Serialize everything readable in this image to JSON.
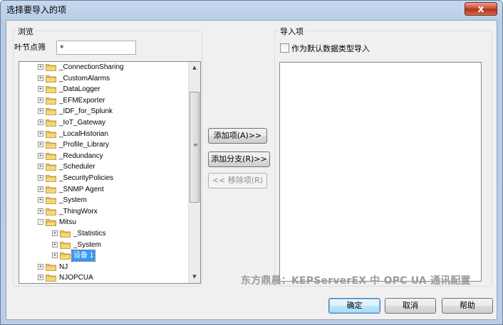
{
  "window": {
    "title": "选择要导入的项",
    "close_label": "x"
  },
  "browse": {
    "group_label": "浏览",
    "leaf_filter_label": "叶节点筛",
    "leaf_filter_value": "*"
  },
  "tree": {
    "items": [
      {
        "label": "_ConnectionSharing",
        "level": 1,
        "expander": "+"
      },
      {
        "label": "_CustomAlarms",
        "level": 1,
        "expander": "+"
      },
      {
        "label": "_DataLogger",
        "level": 1,
        "expander": "+"
      },
      {
        "label": "_EFMExporter",
        "level": 1,
        "expander": "+"
      },
      {
        "label": "_IDF_for_Splunk",
        "level": 1,
        "expander": "+"
      },
      {
        "label": "_IoT_Gateway",
        "level": 1,
        "expander": "+"
      },
      {
        "label": "_LocalHistorian",
        "level": 1,
        "expander": "+"
      },
      {
        "label": "_Profile_Library",
        "level": 1,
        "expander": "+"
      },
      {
        "label": "_Redundancy",
        "level": 1,
        "expander": "+"
      },
      {
        "label": "_Scheduler",
        "level": 1,
        "expander": "+"
      },
      {
        "label": "_SecurityPolicies",
        "level": 1,
        "expander": "+"
      },
      {
        "label": "_SNMP Agent",
        "level": 1,
        "expander": "+"
      },
      {
        "label": "_System",
        "level": 1,
        "expander": "+"
      },
      {
        "label": "_ThingWorx",
        "level": 1,
        "expander": "+"
      },
      {
        "label": "Mitsu",
        "level": 1,
        "expander": "-"
      },
      {
        "label": "_Statistics",
        "level": 2,
        "expander": "+"
      },
      {
        "label": "_System",
        "level": 2,
        "expander": "+"
      },
      {
        "label": "设备 1",
        "level": 2,
        "expander": "+",
        "selected": true
      },
      {
        "label": "NJ",
        "level": 1,
        "expander": "+"
      },
      {
        "label": "NJOPCUA",
        "level": 1,
        "expander": "+"
      }
    ]
  },
  "actions": {
    "add_item": "添加项(A)>>",
    "add_branch": "添加分支(R)>>",
    "remove_item": "<< 移除项(R)"
  },
  "import": {
    "group_label": "导入项",
    "default_type_label": "作为默认数据类型导入"
  },
  "watermark": "东方鼎晨：KEPServerEX 中 OPC UA 通讯配置",
  "footer": {
    "ok": "确定",
    "cancel": "取消",
    "help": "帮助"
  },
  "colors": {
    "selection": "#3399ff",
    "folder": "#f5d779",
    "titlebar": "#c7d9ee"
  }
}
